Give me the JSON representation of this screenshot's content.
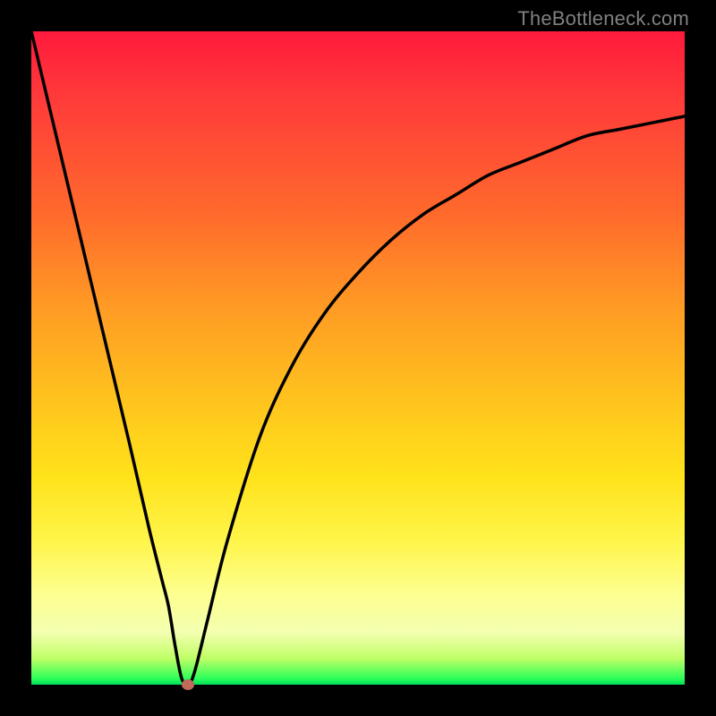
{
  "watermark": "TheBottleneck.com",
  "chart_data": {
    "type": "line",
    "title": "",
    "xlabel": "",
    "ylabel": "",
    "ylim": [
      0,
      100
    ],
    "xlim": [
      0,
      100
    ],
    "series": [
      {
        "name": "bottleneck-curve",
        "x": [
          0,
          5,
          10,
          15,
          18,
          20,
          21,
          22,
          23,
          24,
          25,
          27,
          30,
          35,
          40,
          45,
          50,
          55,
          60,
          65,
          70,
          75,
          80,
          85,
          90,
          95,
          100
        ],
        "values": [
          100,
          79,
          58,
          37,
          24,
          16,
          12,
          6,
          1,
          0,
          2,
          10,
          22,
          38,
          49,
          57,
          63,
          68,
          72,
          75,
          78,
          80,
          82,
          84,
          85,
          86,
          87
        ]
      }
    ],
    "marker": {
      "x": 24,
      "y": 0,
      "color": "#c06a5a"
    },
    "gradient_stops": [
      {
        "pct": 0,
        "color": "#ff1a3c"
      },
      {
        "pct": 10,
        "color": "#ff3a3a"
      },
      {
        "pct": 28,
        "color": "#ff6a2c"
      },
      {
        "pct": 42,
        "color": "#ff9a24"
      },
      {
        "pct": 56,
        "color": "#ffc21e"
      },
      {
        "pct": 68,
        "color": "#ffe21a"
      },
      {
        "pct": 78,
        "color": "#fff54a"
      },
      {
        "pct": 86,
        "color": "#fdff8f"
      },
      {
        "pct": 92,
        "color": "#f4ffb0"
      },
      {
        "pct": 96,
        "color": "#bfff66"
      },
      {
        "pct": 99,
        "color": "#2fff5a"
      },
      {
        "pct": 100,
        "color": "#00e05a"
      }
    ]
  }
}
